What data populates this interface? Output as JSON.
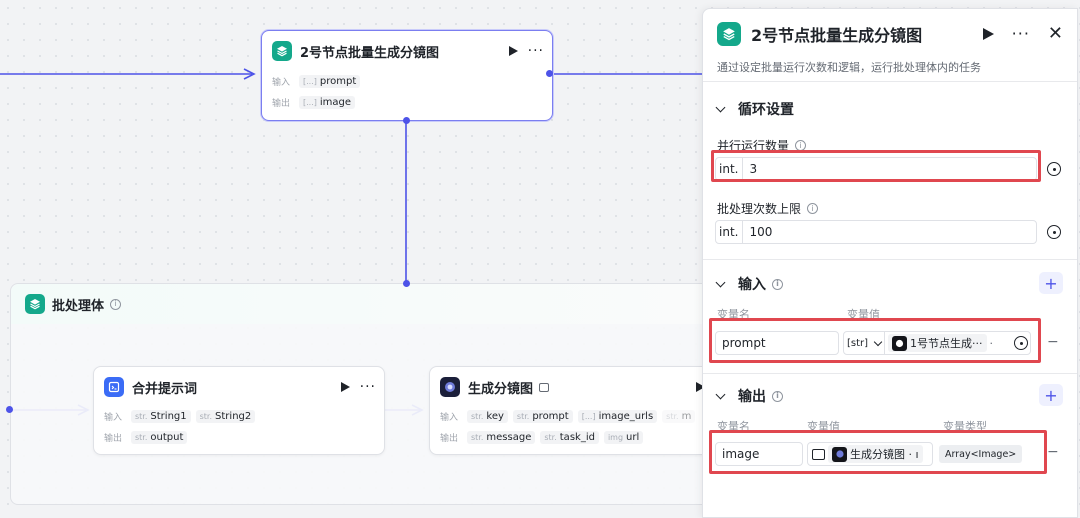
{
  "canvas": {
    "batch_node": {
      "title": "2号节点批量生成分镜图",
      "input_label": "输入",
      "output_label": "输出",
      "input_var": "prompt",
      "output_var": "image",
      "type_prefix": "[...]"
    },
    "batch_body": {
      "title": "批处理体"
    },
    "merge_node": {
      "title": "合并提示词",
      "input_label": "输入",
      "output_label": "输出",
      "inputs": [
        "String1",
        "String2"
      ],
      "outputs": [
        "output"
      ],
      "type_prefix": "str."
    },
    "gen_node": {
      "title": "生成分镜图",
      "input_label": "输入",
      "output_label": "输出",
      "inputs": [
        {
          "t": "str.",
          "name": "key"
        },
        {
          "t": "str.",
          "name": "prompt"
        },
        {
          "t": "[...]",
          "name": "image_urls"
        },
        {
          "t": "str.",
          "name": "m"
        }
      ],
      "outputs": [
        {
          "t": "str.",
          "name": "message"
        },
        {
          "t": "str.",
          "name": "task_id"
        },
        {
          "t": "img",
          "name": "url"
        }
      ]
    }
  },
  "panel": {
    "title": "2号节点批量生成分镜图",
    "description": "通过设定批量运行次数和逻辑，运行批处理体内的任务",
    "loop_section": {
      "title": "循环设置",
      "parallel_label": "并行运行数量",
      "parallel_prefix": "int.",
      "parallel_value": "3",
      "limit_label": "批处理次数上限",
      "limit_prefix": "int.",
      "limit_value": "100"
    },
    "input_section": {
      "title": "输入",
      "col_name": "变量名",
      "col_value": "变量值",
      "var_name": "prompt",
      "type_select": "[str]",
      "ref_value": "1号节点生成···",
      "ref_suffix": "·"
    },
    "output_section": {
      "title": "输出",
      "col_name": "变量名",
      "col_value": "变量值",
      "col_type": "变量类型",
      "var_name": "image",
      "ref_value": "生成分镜图 · ı",
      "var_type": "Array<Image>"
    }
  },
  "colors": {
    "accent": "#4d53e8",
    "node_green": "#14a88b",
    "highlight_red": "#e0474f"
  }
}
